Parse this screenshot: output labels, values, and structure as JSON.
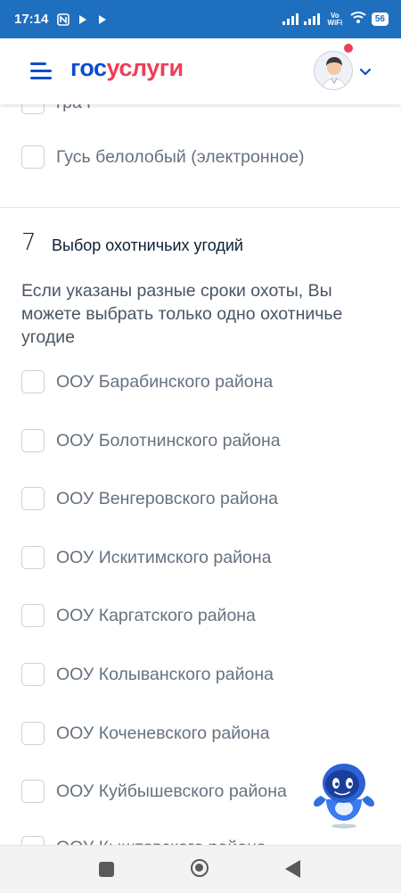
{
  "status_bar": {
    "time": "17:14",
    "volte": "Vo WiFi",
    "battery": "56",
    "icons": [
      "nfc-icon",
      "play-icon",
      "play-icon",
      "signal-icon",
      "signal-icon",
      "wifi-icon",
      "battery-icon"
    ]
  },
  "header": {
    "logo_part1": "гос",
    "logo_part2": "услуги",
    "brand_blue": "#0d4cd3",
    "brand_red": "#ee3f58",
    "icons": [
      "menu-icon",
      "avatar",
      "chevron-down-icon"
    ]
  },
  "prev_section": {
    "partial_label": "гра г",
    "last_option": "Гусь белолобый (электронное)"
  },
  "section": {
    "number": "7",
    "title": "Выбор охотничьих угодий",
    "hint": "Если указаны разные сроки охоты, Вы можете выбрать только одно охотничье угодие",
    "options": [
      "ООУ Барабинского района",
      "ООУ Болотнинского района",
      "ООУ Венгеровского района",
      "ООУ Искитимского района",
      "ООУ Каргатского района",
      "ООУ Колыванского района",
      "ООУ Коченевского района",
      "ООУ Куйбышевского района",
      "ООУ Кыштовского района"
    ]
  },
  "assistant": {
    "icon": "robot-assistant-icon"
  },
  "nav_bar": {
    "icons": [
      "recent-apps-icon",
      "home-icon",
      "back-icon"
    ]
  }
}
